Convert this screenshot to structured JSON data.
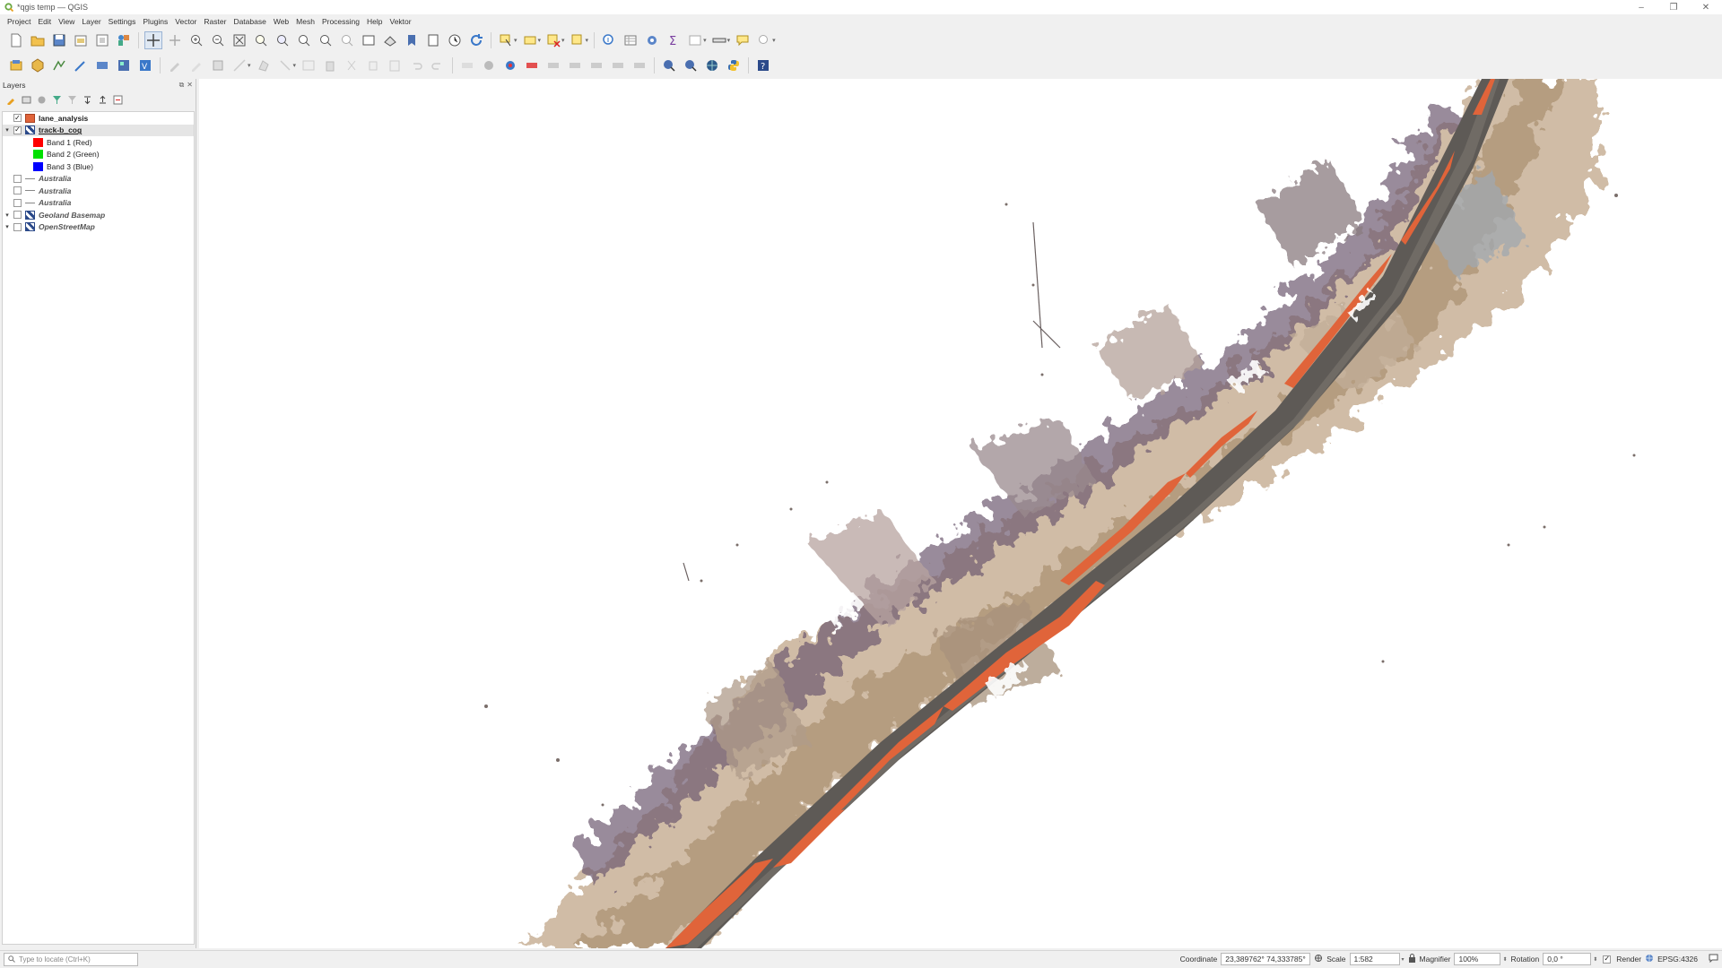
{
  "window": {
    "title": "*qgis temp — QGIS"
  },
  "menu": [
    "Project",
    "Edit",
    "View",
    "Layer",
    "Settings",
    "Plugins",
    "Vector",
    "Raster",
    "Database",
    "Web",
    "Mesh",
    "Processing",
    "Help",
    "Vektor"
  ],
  "layers_panel": {
    "title": "Layers",
    "items": [
      {
        "name": "lane_analysis",
        "checked": true,
        "swatch": "#e0643a"
      },
      {
        "name": "track-b_cog",
        "checked": true
      },
      {
        "name": "Band 1 (Red)",
        "swatch": "#ff0000"
      },
      {
        "name": "Band 2 (Green)",
        "swatch": "#00e000"
      },
      {
        "name": "Band 3 (Blue)",
        "swatch": "#0000ff"
      },
      {
        "name": "Australia",
        "checked": false
      },
      {
        "name": "Australia",
        "checked": false
      },
      {
        "name": "Australia",
        "checked": false
      },
      {
        "name": "Geoland Basemap",
        "checked": false
      },
      {
        "name": "OpenStreetMap",
        "checked": false
      }
    ]
  },
  "statusbar": {
    "locator_placeholder": "Type to locate (Ctrl+K)",
    "coordinate_label": "Coordinate",
    "coordinate_value": "23,389762° 74,333785°",
    "scale_label": "Scale",
    "scale_value": "1:582",
    "magnifier_label": "Magnifier",
    "magnifier_value": "100%",
    "rotation_label": "Rotation",
    "rotation_value": "0,0 °",
    "render_label": "Render",
    "crs_label": "EPSG:4326"
  },
  "colors": {
    "lane_overlay": "#e0643a",
    "road": "#5e5a56",
    "terrain": "#b59a7c",
    "vegetation": "#6e5a70"
  }
}
